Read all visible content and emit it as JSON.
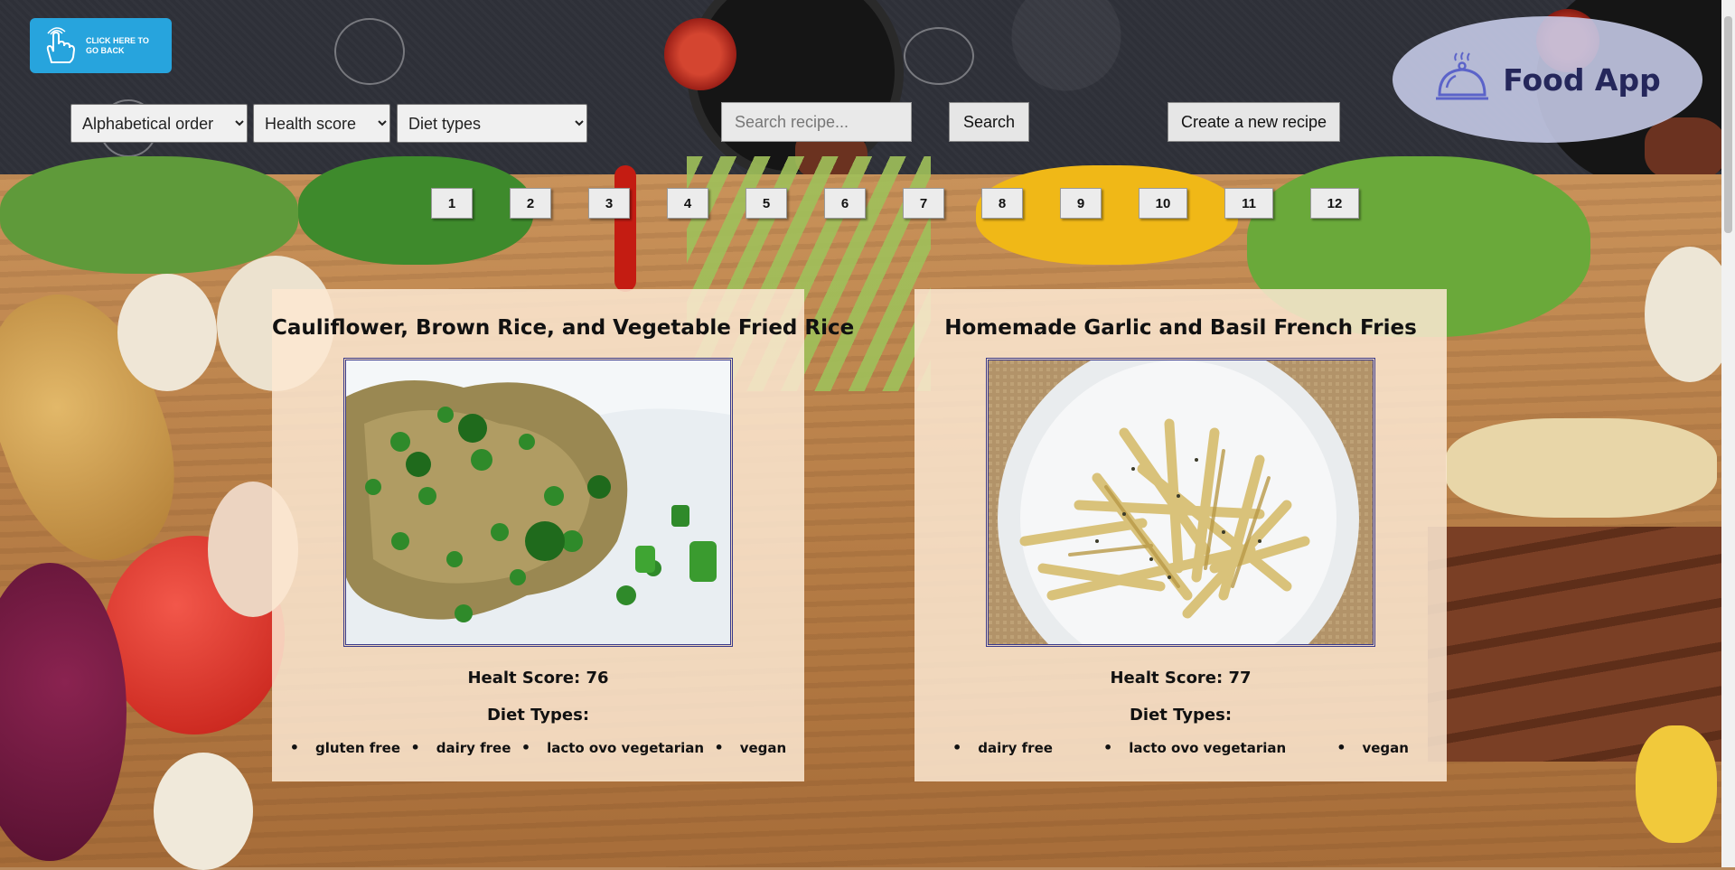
{
  "header": {
    "back_button_label": "CLICK HERE TO GO BACK",
    "sort_alpha": {
      "selected": "Alphabetical order"
    },
    "sort_health": {
      "selected": "Health score"
    },
    "diet_filter": {
      "selected": "Diet types"
    },
    "search": {
      "placeholder": "Search recipe...",
      "value": ""
    },
    "search_button_label": "Search",
    "create_button_label": "Create a new recipe",
    "logo_text": "Food App"
  },
  "pagination": [
    "1",
    "2",
    "3",
    "4",
    "5",
    "6",
    "7",
    "8",
    "9",
    "10",
    "11",
    "12"
  ],
  "recipes": [
    {
      "title": "Cauliflower, Brown Rice, and Vegetable Fried Rice",
      "health_score_label": "Healt Score: 76",
      "diet_types_heading": "Diet Types:",
      "diets": [
        "gluten free",
        "dairy free",
        "lacto ovo vegetarian",
        "vegan"
      ]
    },
    {
      "title": "Homemade Garlic and Basil French Fries",
      "health_score_label": "Healt Score: 77",
      "diet_types_heading": "Diet Types:",
      "diets": [
        "dairy free",
        "lacto ovo vegetarian",
        "vegan"
      ]
    }
  ],
  "colors": {
    "header_bg": "#2e3038",
    "back_button": "#27a4dd",
    "logo_bg": "#c8cdeb",
    "logo_text": "#25275b",
    "card_bg": "#fce8d2"
  }
}
